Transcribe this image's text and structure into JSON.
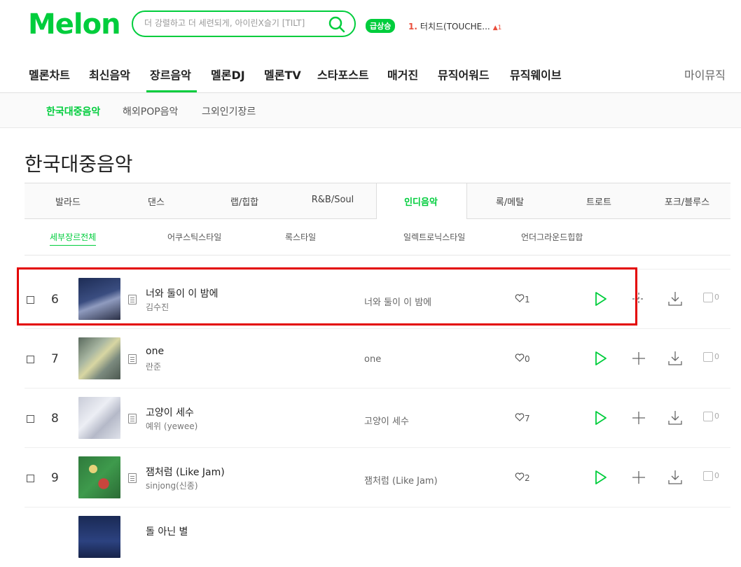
{
  "header": {
    "logo": "Melon",
    "search_placeholder": "더 강렬하고 더 세련되게, 아이린X슬기 [TILT]",
    "badge": "급상승",
    "rank_number": "1.",
    "rank_title": "터치드(TOUCHE...",
    "rank_change": "▲1"
  },
  "gnb": {
    "items": [
      "멜론차트",
      "최신음악",
      "장르음악",
      "멜론DJ",
      "멜론TV",
      "스타포스트",
      "매거진",
      "뮤직어워드",
      "뮤직웨이브"
    ],
    "active": "장르음악",
    "mymusic": "마이뮤직"
  },
  "subnav": {
    "items": [
      "한국대중음악",
      "해외POP음악",
      "그외인기장르"
    ],
    "active": "한국대중음악"
  },
  "page_title": "한국대중음악",
  "genre_tabs": {
    "items": [
      "발라드",
      "댄스",
      "랩/힙합",
      "R&B/Soul",
      "인디음악",
      "록/메탈",
      "트로트",
      "포크/블루스"
    ],
    "active": "인디음악"
  },
  "sub_genres": {
    "items": [
      "세부장르전체",
      "어쿠스틱스타일",
      "록스타일",
      "일렉트로닉스타일",
      "언더그라운드힙합"
    ],
    "active": "세부장르전체"
  },
  "songs": [
    {
      "rank": "6",
      "title": "너와 둘이 이 밤에",
      "artist": "김수진",
      "album": "너와 둘이 이 밤에",
      "likes": "1",
      "mv": "0"
    },
    {
      "rank": "7",
      "title": "one",
      "artist": "란준",
      "album": "one",
      "likes": "0",
      "mv": "0"
    },
    {
      "rank": "8",
      "title": "고양이 세수",
      "artist": "예위 (yewee)",
      "album": "고양이 세수",
      "likes": "7",
      "mv": "0"
    },
    {
      "rank": "9",
      "title": "잼처럼 (Like Jam)",
      "artist": "sinjong(신종)",
      "album": "잼처럼 (Like Jam)",
      "likes": "2",
      "mv": "0"
    },
    {
      "rank": "",
      "title": "돌 아닌 별",
      "artist": "",
      "album": "",
      "likes": "",
      "mv": ""
    }
  ],
  "colors": {
    "accent": "#00cd3c",
    "highlight": "#e30000",
    "rank_up": "#ea4e3c"
  },
  "icons": [
    "search-icon",
    "play-icon",
    "add-icon",
    "download-icon",
    "heart-icon",
    "lyrics-icon",
    "mv-icon"
  ]
}
